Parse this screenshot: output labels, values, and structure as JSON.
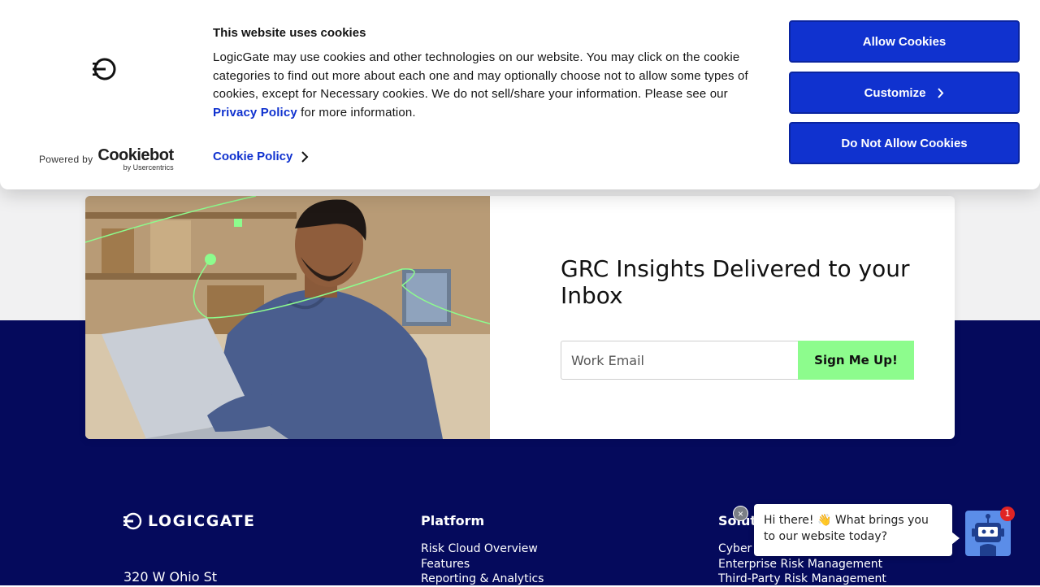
{
  "cookie_banner": {
    "title": "This website uses cookies",
    "body_text": "LogicGate may use cookies and other technologies on our website. You may click on the cookie categories to find out more about each one and may optionally choose not to allow some types of cookies, except for Necessary cookies.  We do not sell/share your information. Please see our ",
    "privacy_link": "Privacy Policy",
    "body_suffix": " for more information.",
    "cookie_policy_link": "Cookie Policy",
    "powered_by": "Powered by",
    "brand": "Cookiebot",
    "brand_sub": "by Usercentrics",
    "buttons": {
      "allow": "Allow Cookies",
      "customize": "Customize",
      "deny": "Do Not Allow Cookies"
    },
    "colors": {
      "button": "#1032cf",
      "link": "#1032cf"
    }
  },
  "newsletter": {
    "heading": "GRC Insights Delivered to your Inbox",
    "email_placeholder": "Work Email",
    "signup_label": "Sign Me Up!",
    "colors": {
      "signup_button": "#8dfc8d"
    }
  },
  "footer": {
    "logo_text": "LOGICGATE",
    "address_line1": "320 W Ohio St",
    "columns": [
      {
        "title": "Platform",
        "links": [
          "Risk Cloud Overview",
          "Features",
          "Reporting & Analytics"
        ]
      },
      {
        "title": "Solutions",
        "links": [
          "Cyber Risk Management",
          "Enterprise Risk Management",
          "Third-Party Risk Management"
        ]
      }
    ],
    "colors": {
      "background": "#050a5c"
    }
  },
  "chat_widget": {
    "message": "Hi there! 👋 What brings you to our website today?",
    "badge_count": "1",
    "close_symbol": "×"
  }
}
